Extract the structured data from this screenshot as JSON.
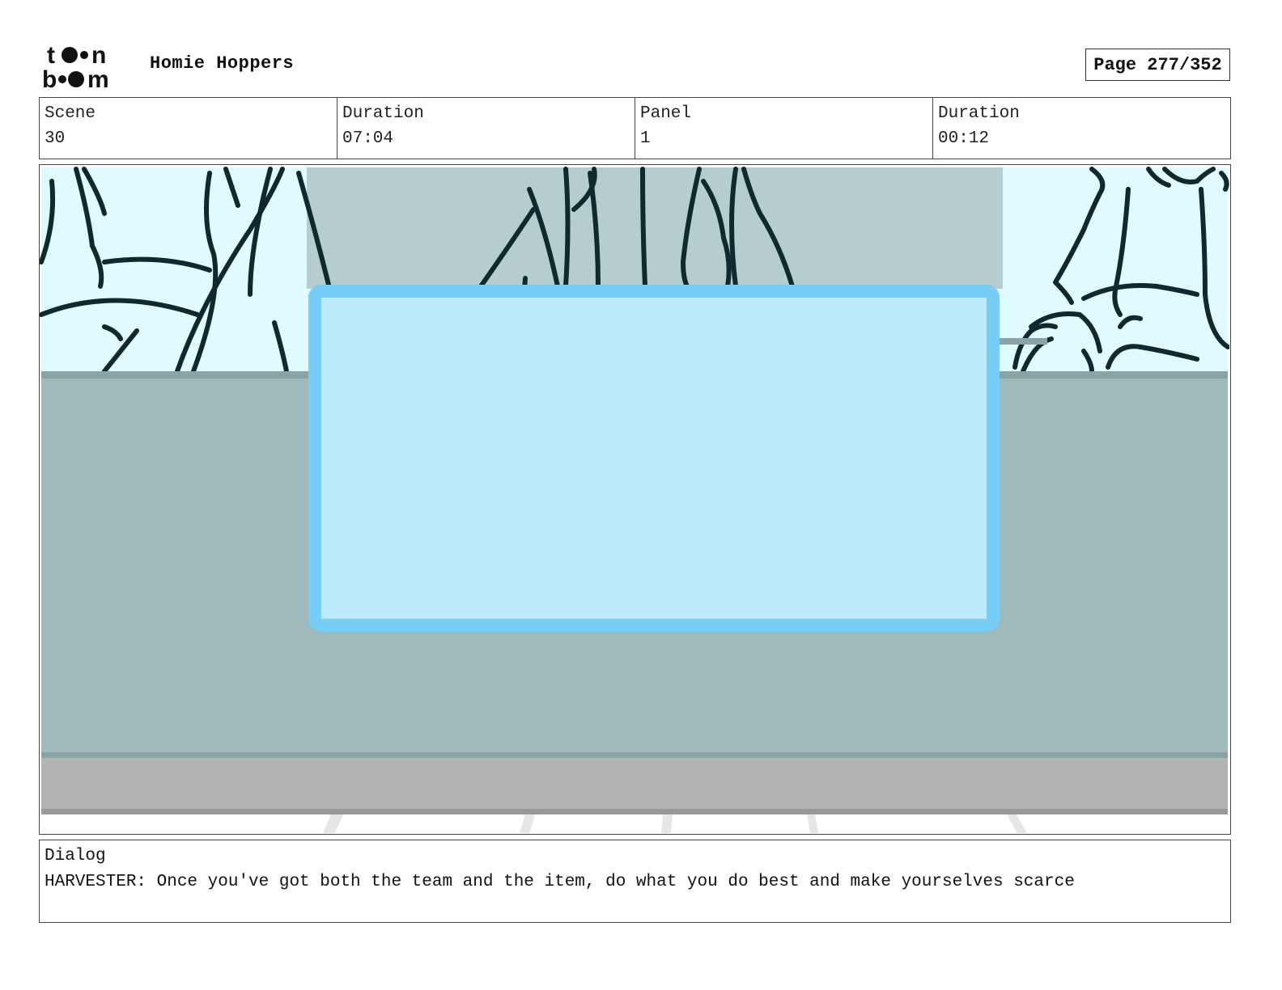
{
  "header": {
    "logo_text": "toon boom",
    "project_title": "Homie Hoppers",
    "page_label": "Page",
    "page_number": "277/352"
  },
  "info": {
    "scene_label": "Scene",
    "scene_value": "30",
    "scene_duration_label": "Duration",
    "scene_duration_value": "07:04",
    "panel_label": "Panel",
    "panel_value": "1",
    "panel_duration_label": "Duration",
    "panel_duration_value": "00:12"
  },
  "dialog": {
    "label": "Dialog",
    "text": "HARVESTER: Once you've got both the team and the item, do what you do best and make yourselves scarce"
  },
  "colors": {
    "sky": "#e0fbff",
    "wall": "#a0b9bb",
    "wall_top": "#b6cdd0",
    "floor": "#b3b3b3",
    "screen_border": "#76cdf6",
    "screen_fill": "#bdeafb",
    "ink": "#0e2a2c"
  }
}
